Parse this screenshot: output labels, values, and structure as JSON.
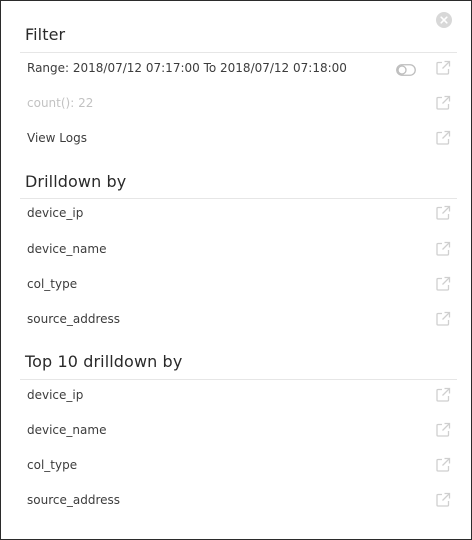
{
  "close_icon": "close-circle-icon",
  "open_icon": "external-link-icon",
  "toggle_icon": "toggle-icon",
  "colors": {
    "text": "#3c3c3c",
    "disabled_text": "#c2c2c2",
    "icon": "#cfcfcf",
    "divider": "#e6e6e6",
    "border": "#2b2b2b"
  },
  "filter": {
    "title": "Filter",
    "items": [
      {
        "label": "Range: 2018/07/12 07:17:00 To 2018/07/12 07:18:00",
        "has_toggle": true,
        "disabled": false
      },
      {
        "label": "count(): 22",
        "has_toggle": false,
        "disabled": true
      },
      {
        "label": "View Logs",
        "has_toggle": false,
        "disabled": false
      }
    ]
  },
  "drilldown": {
    "title": "Drilldown by",
    "items": [
      {
        "label": "device_ip"
      },
      {
        "label": "device_name"
      },
      {
        "label": "col_type"
      },
      {
        "label": "source_address"
      }
    ]
  },
  "top10": {
    "title": "Top 10 drilldown by",
    "items": [
      {
        "label": "device_ip"
      },
      {
        "label": "device_name"
      },
      {
        "label": "col_type"
      },
      {
        "label": "source_address"
      }
    ]
  }
}
